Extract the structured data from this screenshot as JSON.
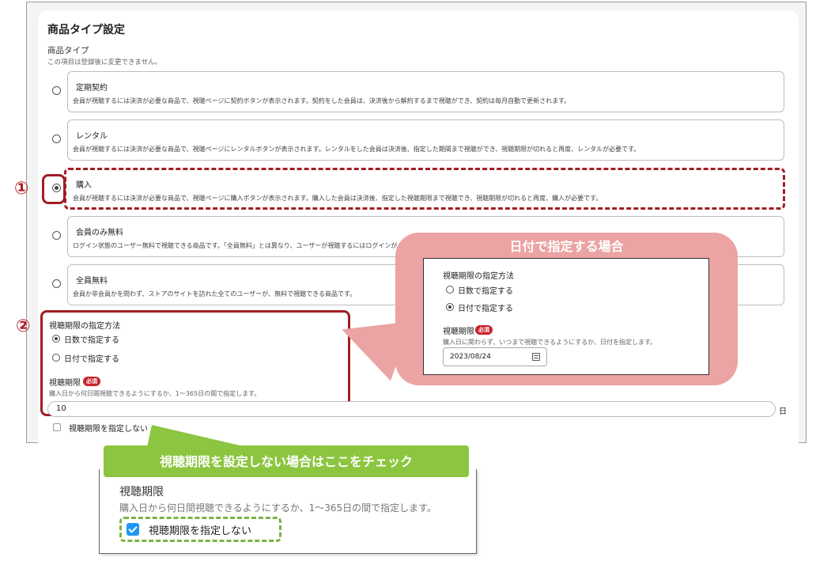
{
  "section_title": "商品タイプ設定",
  "product_type": {
    "label": "商品タイプ",
    "hint": "この項目は登録後に変更できません。",
    "options": [
      {
        "title": "定期契約",
        "desc": "会員が視聴するには決済が必要な商品で、視聴ページに契約ボタンが表示されます。契約をした会員は、決済後から解約するまで視聴ができ、契約は毎月自動で更新されます。",
        "selected": false
      },
      {
        "title": "レンタル",
        "desc": "会員が視聴するには決済が必要な商品で、視聴ページにレンタルボタンが表示されます。レンタルをした会員は決済後、指定した期間まで視聴ができ、視聴期限が切れると再度、レンタルが必要です。",
        "selected": false
      },
      {
        "title": "購入",
        "desc": "会員が視聴するには決済が必要な商品で、視聴ページに購入ボタンが表示されます。購入した会員は決済後、指定した視聴期限まで視聴でき、視聴期限が切れると再度、購入が必要です。",
        "selected": true
      },
      {
        "title": "会員のみ無料",
        "desc": "ログイン状態のユーザー無料で視聴できる商品です。「全員無料」とは異なり、ユーザーが視聴するにはログインが必要です。",
        "selected": false
      },
      {
        "title": "全員無料",
        "desc": "会員か非会員かを問わず、ストアのサイトを訪れた全てのユーザーが、無料で視聴できる商品です。",
        "selected": false
      }
    ]
  },
  "markers": {
    "one": "①",
    "two": "②"
  },
  "period_method": {
    "label": "視聴期限の指定方法",
    "option_days": "日数で指定する",
    "option_date": "日付で指定する",
    "selected": "days"
  },
  "period": {
    "label": "視聴期限",
    "required_badge": "必須",
    "hint": "購入日から何日間視聴できるようにするか、1〜365日の間で指定します。",
    "value": "10",
    "unit": "日",
    "no_limit_label": "視聴期限を指定しない"
  },
  "callout_date": {
    "title": "日付で指定する場合",
    "method_label": "視聴期限の指定方法",
    "option_days": "日数で指定する",
    "option_date": "日付で指定する",
    "period_label": "視聴期限",
    "required_badge": "必須",
    "hint": "購入日に関わらず、いつまで視聴できるようにするか、日付を指定します。",
    "date_value": "2023/08/24"
  },
  "callout_nolimit": {
    "title": "視聴期限を設定しない場合はここをチェック",
    "period_label": "視聴期限",
    "hint": "購入日から何日間視聴できるようにするか、1〜365日の間で指定します。",
    "checkbox_label": "視聴期限を指定しない",
    "checked": true
  },
  "colors": {
    "marker_red": "#a01e23",
    "callout_pink": "#eba3a3",
    "callout_green": "#8cc53f",
    "checkbox_blue": "#2196f3"
  }
}
